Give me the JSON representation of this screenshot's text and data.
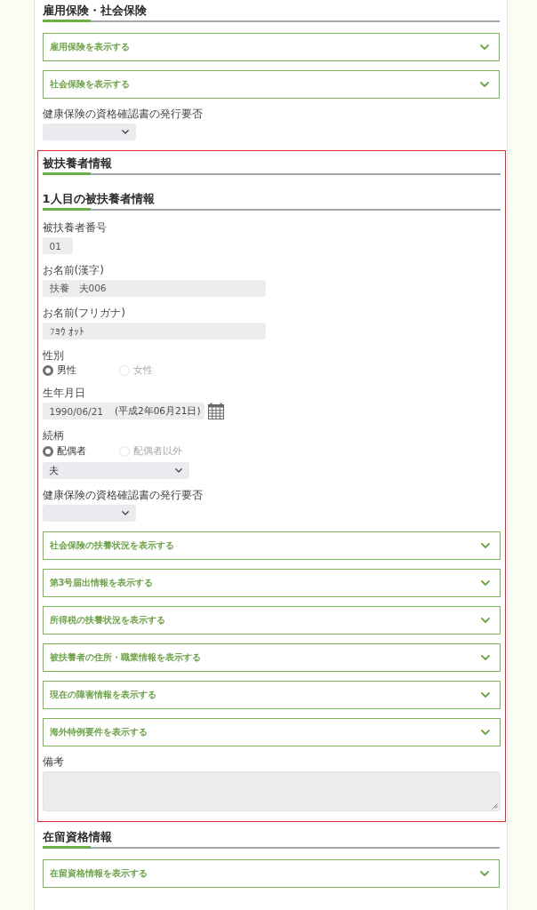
{
  "sections": [
    {
      "title": "雇用保険・社会保険",
      "highlighted": false,
      "items": [
        {
          "kind": "accordion",
          "label": "雇用保険を表示する",
          "expanded": false
        },
        {
          "kind": "accordion",
          "label": "社会保険を表示する",
          "expanded": false
        },
        {
          "kind": "select",
          "label": "健康保険の資格確認書の発行要否"
        }
      ]
    },
    {
      "title": "被扶養者情報",
      "highlighted": true,
      "subtitle": "1人目の被扶養者情報",
      "items": [
        {
          "kind": "short_text",
          "label": "被扶養者番号",
          "value": "01"
        },
        {
          "kind": "text",
          "label": "お名前(漢字)",
          "value": "扶養　夫006"
        },
        {
          "kind": "text",
          "label": "お名前(フリガナ)",
          "value": "ﾌﾖｳ ｵｯﾄ"
        },
        {
          "kind": "radio",
          "label": "性別",
          "options": [
            {
              "label": "男性",
              "selected": true
            },
            {
              "label": "女性",
              "selected": false
            }
          ]
        },
        {
          "kind": "date",
          "label": "生年月日",
          "value": "1990/06/21",
          "era": "(平成2年06月21日)"
        },
        {
          "kind": "radio_select",
          "label": "続柄",
          "options": [
            {
              "label": "配偶者",
              "selected": true
            },
            {
              "label": "配偶者以外",
              "selected": false
            }
          ],
          "value": "夫"
        },
        {
          "kind": "select",
          "label": "健康保険の資格確認書の発行要否"
        },
        {
          "kind": "accordion",
          "label": "社会保険の扶養状況を表示する",
          "expanded": false
        },
        {
          "kind": "accordion",
          "label": "第3号届出情報を表示する",
          "expanded": false
        },
        {
          "kind": "accordion",
          "label": "所得税の扶養状況を表示する",
          "expanded": false
        },
        {
          "kind": "accordion",
          "label": "被扶養者の住所・職業情報を表示する",
          "expanded": false
        },
        {
          "kind": "accordion",
          "label": "現在の障害情報を表示する",
          "expanded": false
        },
        {
          "kind": "accordion",
          "label": "海外特例要件を表示する",
          "expanded": false
        },
        {
          "kind": "textarea",
          "label": "備考"
        }
      ]
    },
    {
      "title": "在留資格情報",
      "highlighted": false,
      "items": [
        {
          "kind": "accordion",
          "label": "在留資格情報を表示する",
          "expanded": false
        }
      ]
    }
  ]
}
